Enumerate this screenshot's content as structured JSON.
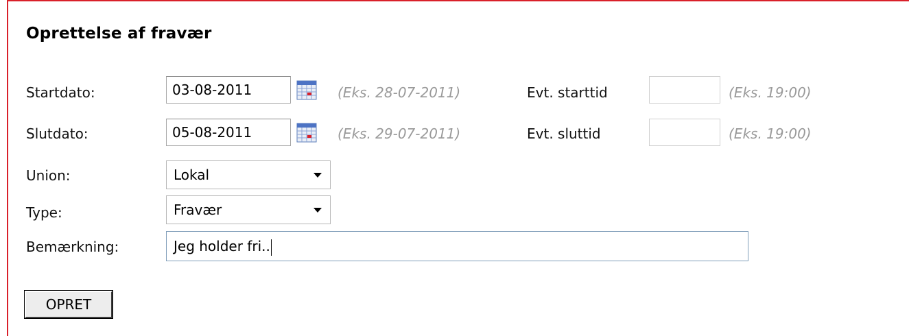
{
  "form": {
    "title": "Oprettelse af fravær",
    "start": {
      "label": "Startdato:",
      "date_value": "03-08-2011",
      "date_hint": "(Eks. 28-07-2011)",
      "time_label": "Evt. starttid",
      "time_value": "",
      "time_hint": "(Eks. 19:00)"
    },
    "end": {
      "label": "Slutdato:",
      "date_value": "05-08-2011",
      "date_hint": "(Eks. 29-07-2011)",
      "time_label": "Evt. sluttid",
      "time_value": "",
      "time_hint": "(Eks. 19:00)"
    },
    "union": {
      "label": "Union:",
      "selected": "Lokal"
    },
    "type": {
      "label": "Type:",
      "selected": "Fravær"
    },
    "remark": {
      "label": "Bemærkning:",
      "value": "Jeg holder fri.."
    },
    "submit_label": "OPRET"
  },
  "icons": {
    "calendar": "calendar-icon",
    "dropdown": "chevron-down-icon"
  },
  "colors": {
    "frame_border": "#d9202a",
    "hint_text": "#9a9a9a",
    "focused_border": "#7f9db9"
  }
}
